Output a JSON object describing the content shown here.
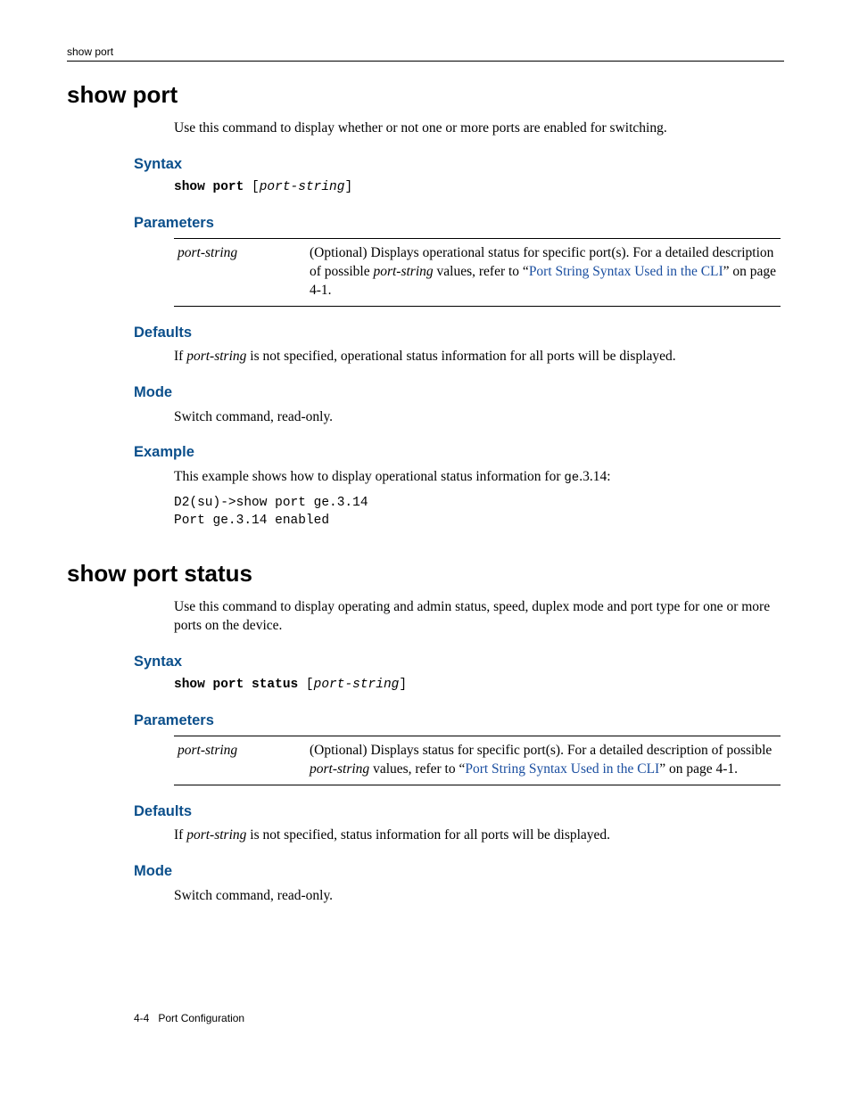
{
  "runningHead": "show port",
  "footer": {
    "pageNum": "4-4",
    "chapter": "Port Configuration"
  },
  "sec1": {
    "title": "show port",
    "intro": "Use this command to display whether or not one or more ports are enabled for switching.",
    "syntaxHead": "Syntax",
    "syntax": {
      "kw": "show port",
      "bracketOpen": " [",
      "arg": "port-string",
      "bracketClose": "]"
    },
    "paramsHead": "Parameters",
    "paramName": "port-string",
    "paramDesc": {
      "p1": "(Optional) Displays operational status for specific port(s). For a detailed description of possible ",
      "italic": "port-string",
      "p2": " values, refer to “",
      "link": "Port String Syntax Used in the CLI",
      "p3": "” on page 4-1."
    },
    "defaultsHead": "Defaults",
    "defaults": {
      "p1": "If ",
      "italic": "port-string",
      "p2": " is not specified, operational status information for all ports will be displayed."
    },
    "modeHead": "Mode",
    "modeText": "Switch command, read-only.",
    "exampleHead": "Example",
    "exampleIntro": {
      "p1": "This example shows how to display operational status information for ",
      "mono": "ge",
      "p2": ".3.14:"
    },
    "code": "D2(su)->show port ge.3.14\nPort ge.3.14 enabled"
  },
  "sec2": {
    "title": "show port status",
    "intro": "Use this command to display operating and admin status, speed, duplex mode and port type for one or more ports on the device.",
    "syntaxHead": "Syntax",
    "syntax": {
      "kw": "show port status",
      "bracketOpen": " [",
      "arg": "port-string",
      "bracketClose": "]"
    },
    "paramsHead": "Parameters",
    "paramName": "port-string",
    "paramDesc": {
      "p1": "(Optional) Displays status for specific port(s). For a detailed description of possible ",
      "italic": "port-string",
      "p2": " values, refer to “",
      "link": "Port String Syntax Used in the CLI",
      "p3": "” on page 4-1."
    },
    "defaultsHead": "Defaults",
    "defaults": {
      "p1": "If ",
      "italic": "port-string",
      "p2": " is not specified, status information for all ports will be displayed."
    },
    "modeHead": "Mode",
    "modeText": "Switch command, read-only."
  }
}
